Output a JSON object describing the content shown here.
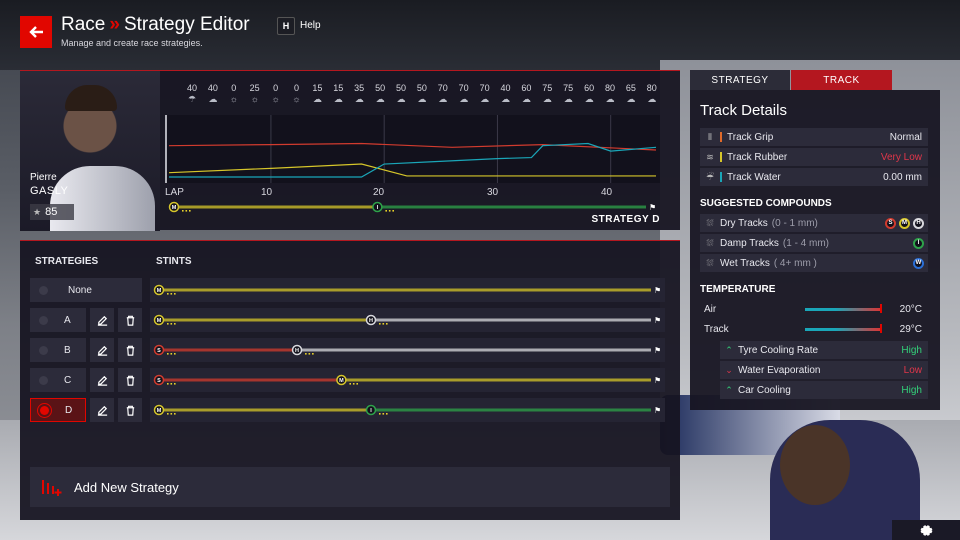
{
  "header": {
    "title_a": "Race",
    "title_sep": "»",
    "title_b": "Strategy Editor",
    "subtitle": "Manage and create race strategies.",
    "help_key": "H",
    "help_label": "Help"
  },
  "driver": {
    "first_name": "Pierre",
    "last_name": "GASLY",
    "rating": "85"
  },
  "weather": [
    {
      "pct": "40",
      "icon": "rain-icon"
    },
    {
      "pct": "40",
      "icon": "cloud-icon"
    },
    {
      "pct": "0",
      "icon": "sun-icon"
    },
    {
      "pct": "25",
      "icon": "sun-icon"
    },
    {
      "pct": "0",
      "icon": "sun-icon"
    },
    {
      "pct": "0",
      "icon": "sun-icon"
    },
    {
      "pct": "15",
      "icon": "cloud-icon"
    },
    {
      "pct": "15",
      "icon": "cloud-icon"
    },
    {
      "pct": "35",
      "icon": "cloud-icon"
    },
    {
      "pct": "50",
      "icon": "cloud-icon"
    },
    {
      "pct": "50",
      "icon": "cloud-icon"
    },
    {
      "pct": "50",
      "icon": "cloud-icon"
    },
    {
      "pct": "70",
      "icon": "cloud-icon"
    },
    {
      "pct": "70",
      "icon": "cloud-icon"
    },
    {
      "pct": "70",
      "icon": "cloud-icon"
    },
    {
      "pct": "40",
      "icon": "cloud-icon"
    },
    {
      "pct": "60",
      "icon": "cloud-icon"
    },
    {
      "pct": "75",
      "icon": "cloud-icon"
    },
    {
      "pct": "75",
      "icon": "cloud-icon"
    },
    {
      "pct": "60",
      "icon": "cloud-icon"
    },
    {
      "pct": "80",
      "icon": "cloud-icon"
    },
    {
      "pct": "65",
      "icon": "cloud-icon"
    },
    {
      "pct": "80",
      "icon": "cloud-icon"
    }
  ],
  "chart": {
    "lap_label": "LAP",
    "ticks": [
      "10",
      "20",
      "30",
      "40"
    ],
    "strategy_label": "STRATEGY D"
  },
  "chart_data": {
    "type": "line",
    "x_label": "LAP",
    "xlim": [
      1,
      44
    ],
    "x_ticks": [
      10,
      20,
      30,
      40
    ],
    "series": [
      {
        "color": "#d13b2e",
        "x": [
          1,
          10,
          18,
          26,
          34,
          44
        ],
        "y": [
          0.58,
          0.6,
          0.62,
          0.55,
          0.6,
          0.5
        ]
      },
      {
        "color": "#d6c62a",
        "x": [
          1,
          10,
          18,
          22,
          44
        ],
        "y": [
          0.08,
          0.16,
          0.24,
          0.02,
          0.02
        ]
      },
      {
        "color": "#1aa6b8",
        "x": [
          1,
          18,
          20,
          24,
          30,
          33,
          34,
          38,
          40,
          44
        ],
        "y": [
          0.0,
          0.0,
          0.24,
          0.28,
          0.34,
          0.36,
          0.58,
          0.62,
          0.48,
          0.55
        ]
      }
    ]
  },
  "strategies": {
    "header": "STRATEGIES",
    "stints_header": "STINTS",
    "add_label": "Add New Strategy",
    "items": [
      {
        "label": "None",
        "selected": false,
        "editable": false,
        "stints": [
          {
            "compound": "M",
            "color": "#d6c62a",
            "to": 1.0
          }
        ]
      },
      {
        "label": "A",
        "selected": false,
        "editable": true,
        "stints": [
          {
            "compound": "M",
            "color": "#d6c62a",
            "to": 0.43
          },
          {
            "compound": "H",
            "color": "#d9d9de",
            "to": 1.0
          }
        ]
      },
      {
        "label": "B",
        "selected": false,
        "editable": true,
        "stints": [
          {
            "compound": "S",
            "color": "#d13b2e",
            "to": 0.28
          },
          {
            "compound": "H",
            "color": "#d9d9de",
            "to": 1.0
          }
        ]
      },
      {
        "label": "C",
        "selected": false,
        "editable": true,
        "stints": [
          {
            "compound": "S",
            "color": "#d13b2e",
            "to": 0.37
          },
          {
            "compound": "M",
            "color": "#d6c62a",
            "to": 1.0
          }
        ]
      },
      {
        "label": "D",
        "selected": true,
        "editable": true,
        "stints": [
          {
            "compound": "M",
            "color": "#d6c62a",
            "to": 0.43
          },
          {
            "compound": "I",
            "color": "#2ea34a",
            "to": 1.0
          }
        ]
      }
    ]
  },
  "track_tabs": {
    "strategy": "STRATEGY",
    "track": "TRACK"
  },
  "track": {
    "title": "Track Details",
    "rows": [
      {
        "label": "Track Grip",
        "value": "Normal",
        "bar_color": "#e06a2a",
        "icon": "grip-icon",
        "value_color": "#e8e8ee"
      },
      {
        "label": "Track Rubber",
        "value": "Very Low",
        "bar_color": "#d6c62a",
        "icon": "rubber-icon",
        "value_color": "#e0364a"
      },
      {
        "label": "Track Water",
        "value": "0.00 mm",
        "bar_color": "#1aa6b8",
        "icon": "water-icon",
        "value_color": "#e8e8ee"
      }
    ],
    "compounds_header": "SUGGESTED COMPOUNDS",
    "compounds": [
      {
        "label": "Dry Tracks",
        "range": "(0 - 1 mm)",
        "tyres": [
          {
            "l": "S",
            "c": "#d13b2e"
          },
          {
            "l": "M",
            "c": "#d6c62a"
          },
          {
            "l": "H",
            "c": "#d9d9de"
          }
        ]
      },
      {
        "label": "Damp Tracks",
        "range": "(1 - 4 mm)",
        "tyres": [
          {
            "l": "I",
            "c": "#2ea34a"
          }
        ]
      },
      {
        "label": "Wet Tracks",
        "range": "( 4+ mm )",
        "tyres": [
          {
            "l": "W",
            "c": "#2b6fd6"
          }
        ]
      }
    ],
    "temperature_header": "TEMPERATURE",
    "temps": [
      {
        "label": "Air",
        "value": "20°C"
      },
      {
        "label": "Track",
        "value": "29°C"
      }
    ],
    "effects": [
      {
        "label": "Tyre Cooling Rate",
        "value": "High",
        "dir": "up",
        "color": "#33d17a"
      },
      {
        "label": "Water Evaporation",
        "value": "Low",
        "dir": "down",
        "color": "#e0364a"
      },
      {
        "label": "Car Cooling",
        "value": "High",
        "dir": "up",
        "color": "#33d17a"
      }
    ]
  }
}
